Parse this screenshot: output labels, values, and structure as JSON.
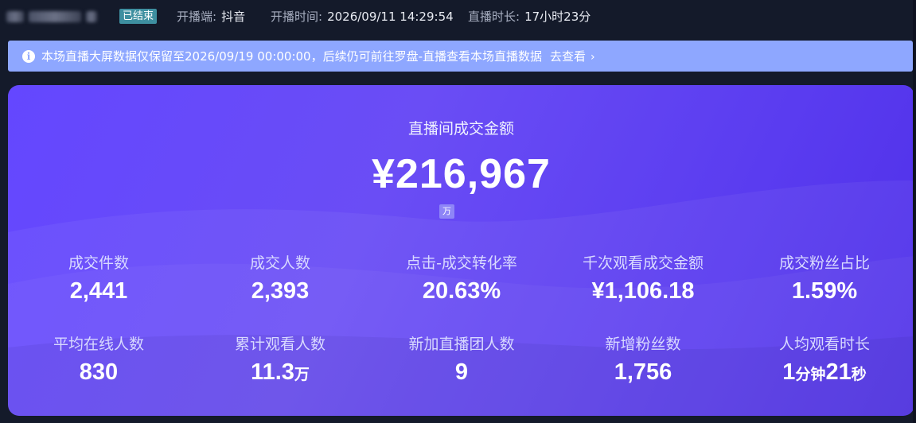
{
  "header": {
    "status_badge": "已结束",
    "platform_label": "开播端:",
    "platform_value": "抖音",
    "start_time_label": "开播时间:",
    "start_time_value": "2026/09/11 14:29:54",
    "duration_label": "直播时长:",
    "duration_value": "17小时23分"
  },
  "notice": {
    "icon": "info-icon",
    "text": "本场直播大屏数据仅保留至2026/09/19 00:00:00，后续仍可前往罗盘-直播查看本场直播数据",
    "link_text": "去查看",
    "link_icon": "chevron-right-icon"
  },
  "card": {
    "gmv_label": "直播间成交金额",
    "gmv_value": "¥216,967",
    "unit_tag": "万",
    "metrics_row1": [
      {
        "label": "成交件数",
        "value": "2,441",
        "unit": ""
      },
      {
        "label": "成交人数",
        "value": "2,393",
        "unit": ""
      },
      {
        "label": "点击-成交转化率",
        "value": "20.63%",
        "unit": ""
      },
      {
        "label": "千次观看成交金额",
        "value": "¥1,106.18",
        "unit": ""
      },
      {
        "label": "成交粉丝占比",
        "value": "1.59%",
        "unit": ""
      }
    ],
    "metrics_row2": [
      {
        "label": "平均在线人数",
        "value": "830",
        "unit": ""
      },
      {
        "label": "累计观看人数",
        "value": "11.3",
        "unit": "万"
      },
      {
        "label": "新加直播团人数",
        "value": "9",
        "unit": ""
      },
      {
        "label": "新增粉丝数",
        "value": "1,756",
        "unit": ""
      },
      {
        "label": "人均观看时长",
        "value_parts": [
          "1",
          "分钟",
          "21",
          "秒"
        ]
      }
    ]
  },
  "colors": {
    "page_bg": "#141a2a",
    "notice_bg": "#8ea7ff",
    "card_gradient_start": "#6447ff",
    "card_gradient_end": "#4f2fe8",
    "status_badge_bg": "#3e8fa0"
  }
}
